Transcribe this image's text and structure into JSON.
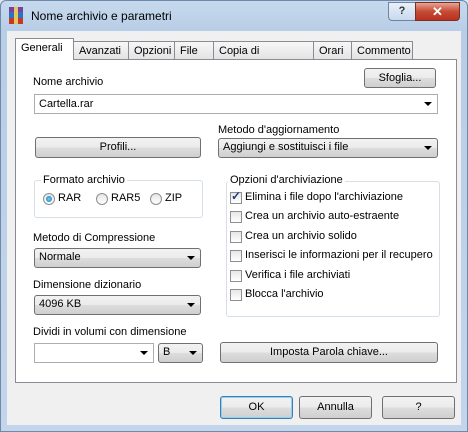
{
  "window": {
    "title": "Nome archivio e parametri",
    "help_label": "?",
    "close_label": "✕"
  },
  "tabs": [
    "Generali",
    "Avanzati",
    "Opzioni",
    "File",
    "Copia di sicurezza",
    "Orari",
    "Commento"
  ],
  "archive_name": {
    "label": "Nome archivio",
    "value": "Cartella.rar",
    "browse_label": "Sfoglia..."
  },
  "profiles_label": "Profili...",
  "update_method": {
    "label": "Metodo d'aggiornamento",
    "value": "Aggiungi e sostituisci i file"
  },
  "archive_format": {
    "label": "Formato archivio",
    "options": [
      "RAR",
      "RAR5",
      "ZIP"
    ],
    "selected": "RAR"
  },
  "compression": {
    "label": "Metodo di Compressione",
    "value": "Normale"
  },
  "dictionary": {
    "label": "Dimensione dizionario",
    "value": "4096 KB"
  },
  "split": {
    "label": "Dividi in volumi con dimensione",
    "value": "",
    "unit": "B"
  },
  "archive_options": {
    "label": "Opzioni d'archiviazione",
    "items": [
      {
        "label": "Elimina i file dopo l'archiviazione",
        "checked": true
      },
      {
        "label": "Crea un archivio auto-estraente",
        "checked": false
      },
      {
        "label": "Crea un archivio solido",
        "checked": false
      },
      {
        "label": "Inserisci le informazioni per il recupero",
        "checked": false
      },
      {
        "label": "Verifica i file archiviati",
        "checked": false
      },
      {
        "label": "Blocca l'archivio",
        "checked": false
      }
    ]
  },
  "password_label": "Imposta Parola chiave...",
  "footer": {
    "ok": "OK",
    "cancel": "Annulla",
    "help": "?"
  },
  "colors": {
    "accent": "#3399ff",
    "close": "#c64b35"
  }
}
